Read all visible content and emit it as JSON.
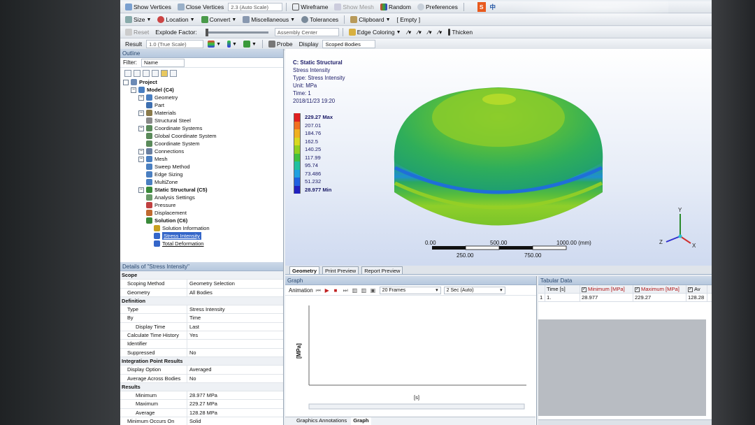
{
  "toolbar1": {
    "show_vertices": "Show Vertices",
    "close_vertices": "Close Vertices",
    "scale": "2.3 (Auto Scale)",
    "wireframe": "Wireframe",
    "show_mesh": "Show Mesh",
    "random": "Random",
    "preferences": "Preferences"
  },
  "toolbar2": {
    "size": "Size",
    "location": "Location",
    "convert": "Convert",
    "miscellaneous": "Miscellaneous",
    "tolerances": "Tolerances",
    "clipboard": "Clipboard",
    "empty": "[ Empty ]"
  },
  "toolbar3": {
    "reset": "Reset",
    "explode_factor": "Explode Factor:",
    "assembly_center": "Assembly Center",
    "edge_coloring": "Edge Coloring",
    "thicken": "Thicken"
  },
  "toolbar4": {
    "result_label": "Result",
    "result_value": "1.0 (True Scale)",
    "probe": "Probe",
    "display": "Display",
    "scoped_bodies": "Scoped Bodies"
  },
  "ime": {
    "s_badge": "S",
    "zh": "中"
  },
  "outline": {
    "title": "Outline",
    "filter_label": "Filter:",
    "filter_value": "Name",
    "tree": [
      {
        "label": "Project",
        "level": 0,
        "bold": true,
        "color": "#6c8ab5"
      },
      {
        "label": "Model (C4)",
        "level": 1,
        "bold": true,
        "color": "#4a7fc1"
      },
      {
        "label": "Geometry",
        "level": 2,
        "bold": false,
        "color": "#4a7fc1"
      },
      {
        "label": "Part",
        "level": 3,
        "bold": false,
        "color": "#3e6fb0"
      },
      {
        "label": "Materials",
        "level": 2,
        "bold": false,
        "color": "#8a7a4a"
      },
      {
        "label": "Structural Steel",
        "level": 3,
        "bold": false,
        "color": "#8a8a8a"
      },
      {
        "label": "Coordinate Systems",
        "level": 2,
        "bold": false,
        "color": "#5a8a5a"
      },
      {
        "label": "Global Coordinate System",
        "level": 3,
        "bold": false,
        "color": "#5a8a5a"
      },
      {
        "label": "Coordinate System",
        "level": 3,
        "bold": false,
        "color": "#5a8a5a"
      },
      {
        "label": "Connections",
        "level": 2,
        "bold": false,
        "color": "#6a7fa0"
      },
      {
        "label": "Mesh",
        "level": 2,
        "bold": false,
        "color": "#4a7fc1"
      },
      {
        "label": "Sweep Method",
        "level": 3,
        "bold": false,
        "color": "#4a7fc1"
      },
      {
        "label": "Edge Sizing",
        "level": 3,
        "bold": false,
        "color": "#4a7fc1"
      },
      {
        "label": "MultiZone",
        "level": 3,
        "bold": false,
        "color": "#4a7fc1"
      },
      {
        "label": "Static Structural (C5)",
        "level": 2,
        "bold": true,
        "color": "#3a8a3a"
      },
      {
        "label": "Analysis Settings",
        "level": 3,
        "bold": false,
        "color": "#6a9a6a"
      },
      {
        "label": "Pressure",
        "level": 3,
        "bold": false,
        "color": "#c04040"
      },
      {
        "label": "Displacement",
        "level": 3,
        "bold": false,
        "color": "#c06a30"
      },
      {
        "label": "Solution (C6)",
        "level": 3,
        "bold": true,
        "color": "#3a8a3a"
      },
      {
        "label": "Solution Information",
        "level": 4,
        "bold": false,
        "color": "#c8a020"
      },
      {
        "label": "Stress Intensity",
        "level": 4,
        "bold": false,
        "color": "#3466c9",
        "selected": true
      },
      {
        "label": "Total Deformation",
        "level": 4,
        "bold": false,
        "color": "#3466c9"
      }
    ]
  },
  "details": {
    "title": "Details of \"Stress Intensity\"",
    "rows": [
      {
        "k": "Scope",
        "group": true
      },
      {
        "k": "Scoping Method",
        "v": "Geometry Selection"
      },
      {
        "k": "Geometry",
        "v": "All Bodies"
      },
      {
        "k": "Definition",
        "group": true
      },
      {
        "k": "Type",
        "v": "Stress Intensity"
      },
      {
        "k": "By",
        "v": "Time"
      },
      {
        "k": "Display Time",
        "v": "Last",
        "indent": true
      },
      {
        "k": "Calculate Time History",
        "v": "Yes"
      },
      {
        "k": "Identifier",
        "v": ""
      },
      {
        "k": "Suppressed",
        "v": "No"
      },
      {
        "k": "Integration Point Results",
        "group": true
      },
      {
        "k": "Display Option",
        "v": "Averaged"
      },
      {
        "k": "Average Across Bodies",
        "v": "No"
      },
      {
        "k": "Results",
        "group": true
      },
      {
        "k": "Minimum",
        "v": "28.977 MPa",
        "indent": true
      },
      {
        "k": "Maximum",
        "v": "229.27 MPa",
        "indent": true
      },
      {
        "k": "Average",
        "v": "128.28 MPa",
        "indent": true
      },
      {
        "k": "Minimum Occurs On",
        "v": "Solid"
      }
    ]
  },
  "viewport": {
    "title": "C: Static Structural",
    "line1": "Stress Intensity",
    "line2": "Type: Stress Intensity",
    "line3": "Unit: MPa",
    "line4": "Time: 1",
    "line5": "2018/11/23 19:20",
    "legend": [
      {
        "label": "229.27 Max",
        "color": "#e02020",
        "bold": true
      },
      {
        "label": "207.01",
        "color": "#f07020"
      },
      {
        "label": "184.76",
        "color": "#f0b020"
      },
      {
        "label": "162.5",
        "color": "#d8d820"
      },
      {
        "label": "140.25",
        "color": "#90d020"
      },
      {
        "label": "117.99",
        "color": "#40c040"
      },
      {
        "label": "95.74",
        "color": "#20c0a0"
      },
      {
        "label": "73.486",
        "color": "#20a0e0"
      },
      {
        "label": "51.232",
        "color": "#2060e0"
      },
      {
        "label": "28.977 Min",
        "color": "#2020c0",
        "bold": true
      }
    ],
    "scale_labels_top": [
      "0.00",
      "500.00",
      "1000.00 (mm)"
    ],
    "scale_labels_bottom": [
      "250.00",
      "750.00"
    ],
    "axis_x": "X",
    "axis_y": "Y",
    "axis_z": "Z"
  },
  "view_tabs": [
    "Geometry",
    "Print Preview",
    "Report Preview"
  ],
  "graph": {
    "title": "Graph",
    "animation_label": "Animation",
    "frames": "20 Frames",
    "duration": "2 Sec (Auto)",
    "ylabel": "[MPa]",
    "xlabel": "[s]",
    "tabs": [
      "Graphics Annotations",
      "Graph"
    ]
  },
  "tabular": {
    "title": "Tabular Data",
    "headers": [
      "Time [s]",
      "Minimum [MPa]",
      "Maximum [MPa]",
      "Av"
    ],
    "rows": [
      {
        "idx": "1",
        "time": "1.",
        "min": "28.977",
        "max": "229.27",
        "avg": "128.28"
      }
    ]
  },
  "colors": {
    "selection": "#3466c9",
    "panel_title": "#2c4a70"
  }
}
